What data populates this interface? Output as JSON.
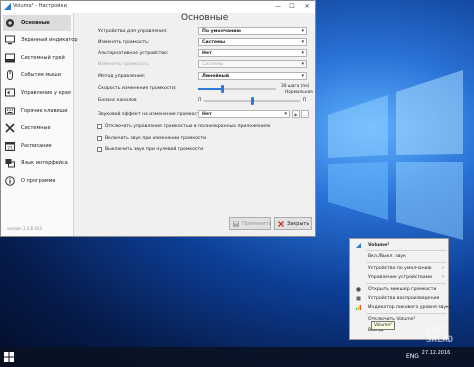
{
  "window": {
    "title": "Volume² - Настройки",
    "minimize": "—",
    "maximize": "☐",
    "close": "✕"
  },
  "sidebar": {
    "items": [
      {
        "label": "Основные",
        "icon": "gear-icon"
      },
      {
        "label": "Экранный индикатор",
        "icon": "monitor-icon"
      },
      {
        "label": "Системный трей",
        "icon": "tray-icon"
      },
      {
        "label": "События мыши",
        "icon": "mouse-icon"
      },
      {
        "label": "Управление у края",
        "icon": "screen-edge-icon"
      },
      {
        "label": "Горячие клавиши",
        "icon": "keyboard-icon"
      },
      {
        "label": "Системные",
        "icon": "tools-icon"
      },
      {
        "label": "Расписание",
        "icon": "calendar-icon"
      },
      {
        "label": "Язык интерфейса",
        "icon": "language-icon"
      },
      {
        "label": "О программе",
        "icon": "info-icon"
      }
    ],
    "version": "version 1.1.6.413"
  },
  "main": {
    "title": "Основные",
    "rows": [
      {
        "label": "Устройство для управления:",
        "value": "По умолчанию",
        "enabled": true
      },
      {
        "label": "Изменять громкость:",
        "value": "Системы",
        "enabled": true
      },
      {
        "label": "Альтернативное устройство:",
        "value": "Нет",
        "enabled": true
      },
      {
        "label": "Изменять громкость:",
        "value": "Системы",
        "enabled": false
      },
      {
        "label": "Метод управления:",
        "value": "Линейный",
        "enabled": true
      }
    ],
    "speed": {
      "label": "Скорость изменения громкости:",
      "value_text": "30 шага (по)",
      "mode": "Нормальная",
      "level": 0.3
    },
    "balance": {
      "label": "Баланс каналов",
      "left": "П",
      "right": "П",
      "level": 0.5
    },
    "effect": {
      "label": "Звуковой эффект на изменение громкости:",
      "value": "Нет",
      "play": "▶",
      "more": "…"
    },
    "checkboxes": [
      {
        "label": "Отключать управление громкостью в полноэкранных приложениях",
        "checked": false
      },
      {
        "label": "Включить звук при изменении громкости",
        "checked": false
      },
      {
        "label": "Выключить звук при нулевой громкости",
        "checked": false
      }
    ],
    "buttons": {
      "apply": "Применить",
      "close": "Закрыть"
    }
  },
  "tray_menu": {
    "header": "Volume²",
    "items": [
      {
        "label": "Вкл./Выкл. звук",
        "submenu": false
      },
      {
        "label": "Устройство по умолчанию",
        "submenu": true
      },
      {
        "label": "Управление устройствами",
        "submenu": true
      },
      {
        "label": "Открыть микшер громкости",
        "submenu": false
      },
      {
        "label": "Устройства воспроизведения",
        "submenu": false
      },
      {
        "label": "Индикатор пикового уровня звука",
        "submenu": false
      },
      {
        "label": "Отключить Volume²",
        "submenu": false
      },
      {
        "label": "Выход",
        "submenu": false
      }
    ],
    "tooltip": "Volume²"
  },
  "taskbar": {
    "ime": "ENG",
    "time": "",
    "date": "27.12.2016"
  },
  "watermark": "SOFT\nSALAD",
  "colors": {
    "accent": "#2d7ad6",
    "window_bg": "#f0f0f0"
  }
}
